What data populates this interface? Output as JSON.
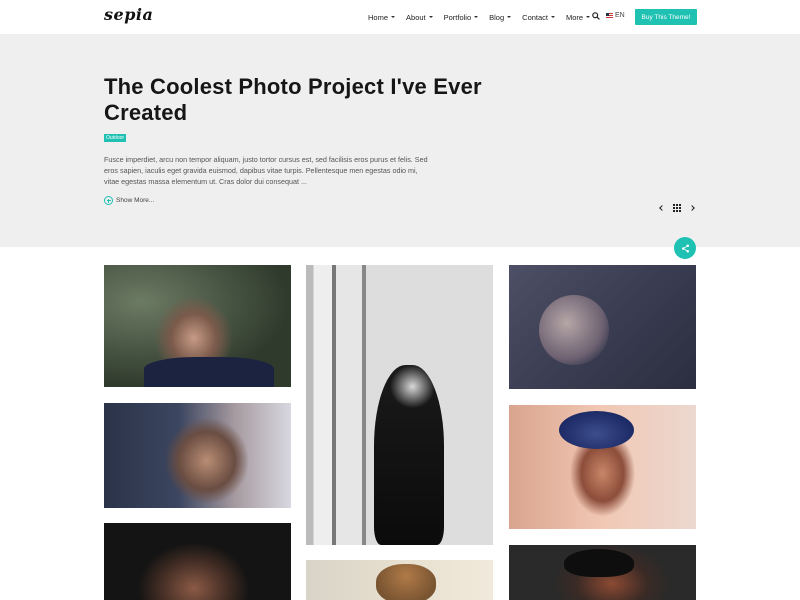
{
  "header": {
    "logo": "sepia",
    "nav": [
      {
        "label": "Home"
      },
      {
        "label": "About"
      },
      {
        "label": "Portfolio"
      },
      {
        "label": "Blog"
      },
      {
        "label": "Contact"
      },
      {
        "label": "More"
      }
    ],
    "lang": "EN",
    "cta_label": "Buy This Theme!"
  },
  "hero": {
    "title": "The Coolest Photo Project I've Ever Created",
    "tag": "Outdoor",
    "text": "Fusce imperdiet, arcu non tempor aliquam, justo tortor cursus est, sed facilisis eros purus et felis. Sed eros sapien, iaculis eget gravida euismod, dapibus vitae turpis. Pellentesque men egestas odio mi, vitae egestas massa elementum ut. Cras dolor dui consequat ...",
    "show_more": "Show More..."
  },
  "colors": {
    "accent": "#1ec1b2",
    "hero_bg": "#efefef"
  },
  "icons": [
    "search-icon",
    "flag-icon",
    "plus-circle-icon",
    "chevron-left-icon",
    "grid-icon",
    "chevron-right-icon",
    "share-icon"
  ],
  "gallery": {
    "photos": [
      {
        "subject": "woman-dark-hair"
      },
      {
        "subject": "woman-black-white-fence"
      },
      {
        "subject": "woman-in-chair"
      },
      {
        "subject": "tattooed-woman"
      },
      {
        "subject": "woman-blue-hat"
      },
      {
        "subject": "woman-portrait"
      },
      {
        "subject": "child-portrait"
      },
      {
        "subject": "woman-black-hat"
      }
    ]
  }
}
